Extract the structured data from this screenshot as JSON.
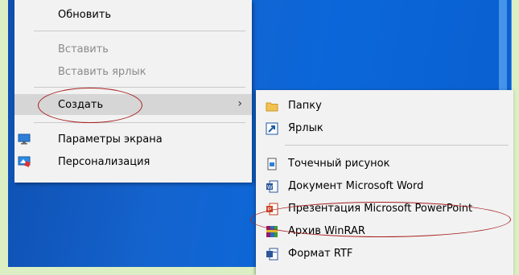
{
  "context_menu": {
    "items": [
      {
        "label": "Обновить",
        "enabled": true
      },
      {
        "label": "Вставить",
        "enabled": false
      },
      {
        "label": "Вставить ярлык",
        "enabled": false
      },
      {
        "label": "Создать",
        "enabled": true,
        "submenu_arrow": "›"
      },
      {
        "label": "Параметры экрана",
        "enabled": true,
        "icon": "display-icon"
      },
      {
        "label": "Персонализация",
        "enabled": true,
        "icon": "personalize-icon"
      }
    ]
  },
  "submenu": {
    "items": [
      {
        "label": "Папку",
        "icon": "folder-icon"
      },
      {
        "label": "Ярлык",
        "icon": "shortcut-icon"
      },
      {
        "label": "Точечный рисунок",
        "icon": "bitmap-icon"
      },
      {
        "label": "Документ Microsoft Word",
        "icon": "word-icon"
      },
      {
        "label": "Презентация Microsoft PowerPoint",
        "icon": "powerpoint-icon"
      },
      {
        "label": "Архив WinRAR",
        "icon": "winrar-icon"
      },
      {
        "label": "Формат RTF",
        "icon": "rtf-icon"
      }
    ]
  },
  "colors": {
    "annotation_circle": "#a82020",
    "desktop": "#1464cf",
    "frame": "#dcefc4"
  }
}
